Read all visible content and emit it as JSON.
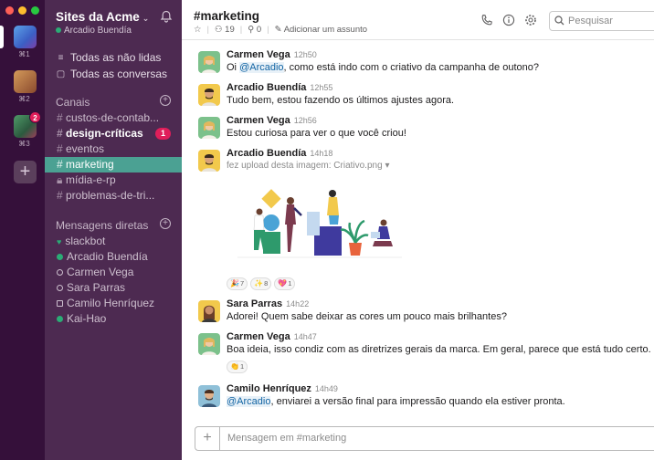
{
  "workspaces": [
    {
      "key": "⌘1",
      "color": "#4a7fd4",
      "selected": true
    },
    {
      "key": "⌘2",
      "color": "#b57a4a"
    },
    {
      "key": "⌘3",
      "color": "#3e7a56",
      "badge": "2"
    }
  ],
  "sidebar": {
    "team_name": "Sites da Acme",
    "user": "Arcadio Buendía",
    "nav": [
      {
        "label": "Todas as não lidas",
        "icon": "unreads-icon"
      },
      {
        "label": "Todas as conversas",
        "icon": "threads-icon"
      }
    ],
    "channels_title": "Canais",
    "channels": [
      {
        "name": "custos-de-contab...",
        "bold": false
      },
      {
        "name": "design-críticas",
        "bold": true,
        "badge": "1"
      },
      {
        "name": "eventos",
        "bold": false
      },
      {
        "name": "marketing",
        "active": true
      },
      {
        "name": "mídia-e-rp",
        "locked": true
      },
      {
        "name": "problemas-de-tri...",
        "bold": false
      }
    ],
    "dms_title": "Mensagens diretas",
    "dms": [
      {
        "name": "slackbot",
        "presence": "heart"
      },
      {
        "name": "Arcadio Buendía",
        "presence": "on"
      },
      {
        "name": "Carmen Vega",
        "presence": "off"
      },
      {
        "name": "Sara Parras",
        "presence": "off"
      },
      {
        "name": "Camilo Henríquez",
        "presence": "sq"
      },
      {
        "name": "Kai-Hao",
        "presence": "on"
      }
    ]
  },
  "header": {
    "channel": "#marketing",
    "members": "19",
    "pins": "0",
    "topic": "Adicionar um assunto",
    "search_placeholder": "Pesquisar"
  },
  "messages": [
    {
      "name": "Carmen Vega",
      "time": "12h50",
      "pre": "Oi ",
      "mention": "@Arcadio",
      "post": ", como está indo com o criativo da campanha de outono?"
    },
    {
      "name": "Arcadio Buendía",
      "time": "12h55",
      "text": "Tudo bem, estou fazendo os últimos ajustes agora."
    },
    {
      "name": "Carmen Vega",
      "time": "12h56",
      "text": "Estou curiosa para ver o que você criou!"
    },
    {
      "name": "Arcadio Buendía",
      "time": "14h18",
      "upload_text": "fez upload desta imagem: Criativo.png",
      "reactions": [
        {
          "emoji": "🎉",
          "count": "7"
        },
        {
          "emoji": "✨",
          "count": "8"
        },
        {
          "emoji": "💖",
          "count": "1"
        }
      ]
    },
    {
      "name": "Sara Parras",
      "time": "14h22",
      "text": "Adorei! Quem sabe deixar as cores um pouco mais brilhantes?"
    },
    {
      "name": "Carmen Vega",
      "time": "14h47",
      "text": "Boa ideia, isso condiz com as diretrizes gerais da marca. Em geral, parece que está tudo certo.",
      "reactions": [
        {
          "emoji": "👏",
          "count": "1"
        }
      ]
    },
    {
      "name": "Camilo Henríquez",
      "time": "14h49",
      "pre": "",
      "mention": "@Arcadio",
      "post": ", enviarei a versão final para impressão quando ela estiver pronta."
    }
  ],
  "composer": {
    "placeholder": "Mensagem em #marketing"
  }
}
